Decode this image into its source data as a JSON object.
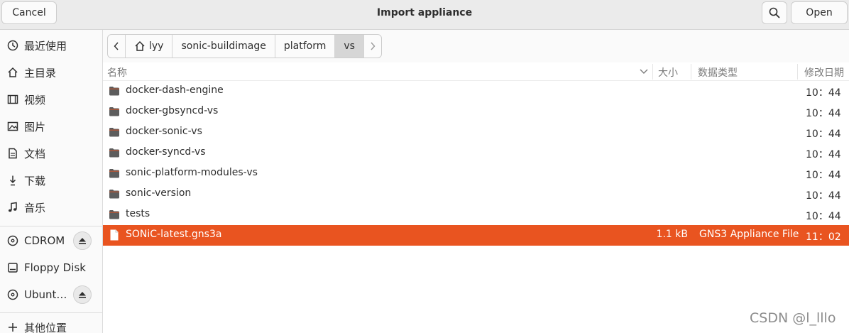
{
  "header": {
    "cancel_label": "Cancel",
    "title": "Import appliance",
    "open_label": "Open"
  },
  "sidebar": {
    "items": [
      {
        "label": "最近使用",
        "icon": "clock-icon"
      },
      {
        "label": "主目录",
        "icon": "home-icon"
      },
      {
        "label": "视频",
        "icon": "film-icon"
      },
      {
        "label": "图片",
        "icon": "image-icon"
      },
      {
        "label": "文档",
        "icon": "document-icon"
      },
      {
        "label": "下载",
        "icon": "download-icon"
      },
      {
        "label": "音乐",
        "icon": "music-icon"
      }
    ],
    "devices": [
      {
        "label": "CDROM",
        "icon": "disc-icon",
        "eject": true
      },
      {
        "label": "Floppy Disk",
        "icon": "drive-icon",
        "eject": false
      },
      {
        "label": "Ubunt…",
        "icon": "disc-icon",
        "eject": true
      }
    ],
    "other": {
      "label": "其他位置",
      "icon": "plus-icon"
    }
  },
  "path": {
    "crumbs": [
      "lyy",
      "sonic-buildimage",
      "platform",
      "vs"
    ]
  },
  "columns": {
    "name": "名称",
    "size": "大小",
    "type": "数据类型",
    "date": "修改日期"
  },
  "files": [
    {
      "name": "docker-dash-engine",
      "kind": "folder",
      "size": "",
      "type": "",
      "date": "10：44"
    },
    {
      "name": "docker-gbsyncd-vs",
      "kind": "folder",
      "size": "",
      "type": "",
      "date": "10：44"
    },
    {
      "name": "docker-sonic-vs",
      "kind": "folder",
      "size": "",
      "type": "",
      "date": "10：44"
    },
    {
      "name": "docker-syncd-vs",
      "kind": "folder",
      "size": "",
      "type": "",
      "date": "10：44"
    },
    {
      "name": "sonic-platform-modules-vs",
      "kind": "folder",
      "size": "",
      "type": "",
      "date": "10：44"
    },
    {
      "name": "sonic-version",
      "kind": "folder",
      "size": "",
      "type": "",
      "date": "10：44"
    },
    {
      "name": "tests",
      "kind": "folder",
      "size": "",
      "type": "",
      "date": "10：44"
    },
    {
      "name": "SONiC-latest.gns3a",
      "kind": "file",
      "size": "1.1 kB",
      "type": "GNS3 Appliance File",
      "date": "11：02",
      "selected": true
    }
  ],
  "watermark": "CSDN @l_lllo",
  "colors": {
    "accent": "#e95420",
    "folder": "#5d5d5d"
  }
}
